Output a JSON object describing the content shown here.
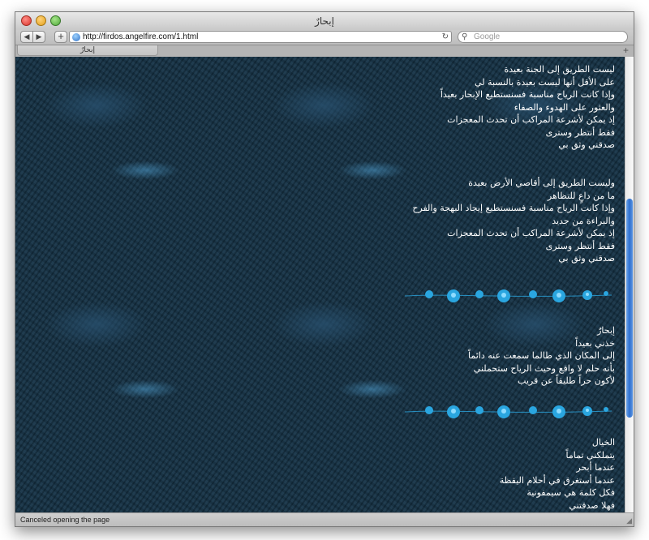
{
  "window": {
    "title": "إبحارٌ"
  },
  "toolbar": {
    "back_icon": "back-arrow-icon",
    "forward_icon": "forward-arrow-icon",
    "add_icon": "plus-icon",
    "url": "http://firdos.angelfire.com/1.html",
    "reload_icon": "reload-icon",
    "search_placeholder": "Google"
  },
  "tabs": [
    {
      "label": "إبحارٌ"
    }
  ],
  "status": {
    "text": "Canceled opening the page"
  },
  "colors": {
    "poem_text": "#ffffff",
    "background": "#173448",
    "rose": "#2aa6e0"
  },
  "poem": {
    "stanza1": [
      "ليست الطريق إلى الجنة بعيدة",
      "على الأقل أنها ليست بعيدة بالنسبة لي",
      "وإذا كانت الرياح مناسبة فسنستطيع الإبحار بعيداً",
      "والعثور على الهدوء والصفاء",
      "إذ يمكن لأشرعة المراكب أن تحدث المعجزات",
      "فقط أنتظر وسترى",
      "صدقني وثق بي"
    ],
    "stanza2": [
      "وليست الطريق إلى أقاصي الأرض بعيدة",
      "ما من داعٍ للتظاهر",
      "وإذا كانت الرياح مناسبة فسنستطيع إيجاد البهجة والفرح",
      "والبراءة من جديد",
      "إذ يمكن لأشرعة المراكب أن تحدث المعجزات",
      "فقط أنتظر وسترى",
      "صدقني وثق بي"
    ],
    "stanza3": [
      "إبحارٌ",
      "خذني بعيداً",
      "إلى المكان الذي طالما سمعت عنه دائماً",
      "بأنه حلم لا واقع وحيث الرياح ستحملني",
      "لأكون حراً طليقاً عن قريب"
    ],
    "stanza4": [
      "الخيال",
      "يتملكني تماماً",
      "عندما أبحر",
      "عندما أستغرق في أحلام اليقظة",
      "فكل كلمة هي سيمفونية",
      "فهلا صدقتني"
    ]
  }
}
